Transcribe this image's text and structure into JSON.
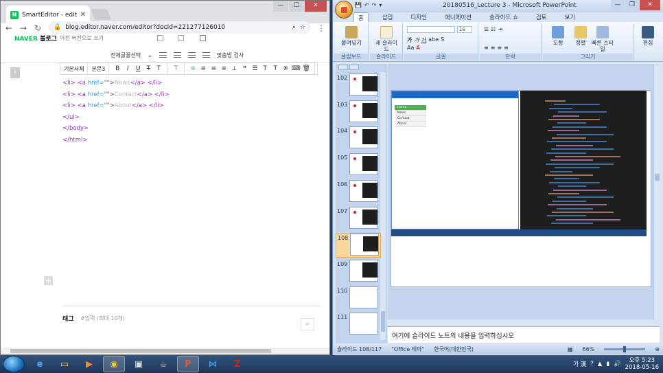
{
  "chrome": {
    "tab_title": "SmartEditor - editor",
    "url": "blog.editor.naver.com/editor?docId=221277126010",
    "header": {
      "logo_naver": "NAVER",
      "logo_blog": "블로그",
      "prev_version": "이전 버전으로 쓰기"
    },
    "toolbar1": {
      "font_size_select": "전체글꼴선택",
      "spellcheck": "맞춤법 검사"
    },
    "toolbar2": {
      "style_select": "기본서체",
      "size_select": "본문3"
    },
    "code_lines": [
      {
        "pre": "<li> <a ",
        "attr": "href=",
        "str": "\"\">",
        "text": "News",
        "post": "</a> </li>"
      },
      {
        "pre": "<li> <a ",
        "attr": "href=",
        "str": "\"\">",
        "text": "Contact",
        "post": "</a> </li>"
      },
      {
        "pre": "<li> <a ",
        "attr": "href=",
        "str": "\"\">",
        "text": "About",
        "post": "</a> </li>"
      },
      {
        "pre": "</ul>",
        "attr": "",
        "str": "",
        "text": "",
        "post": ""
      },
      {
        "pre": "</body>",
        "attr": "",
        "str": "",
        "text": "",
        "post": ""
      },
      {
        "pre": "</html>",
        "attr": "",
        "str": "",
        "text": "",
        "post": ""
      }
    ],
    "tag_label": "태그",
    "tag_placeholder": "#입력 (최대 10개)"
  },
  "ppt": {
    "title": "20180516_Lecture 3 - Microsoft PowerPoint",
    "tabs": [
      "홈",
      "삽입",
      "디자인",
      "애니메이션",
      "슬라이드 쇼",
      "검토",
      "보기"
    ],
    "active_tab": "홈",
    "groups": {
      "clipboard": {
        "label": "클립보드",
        "paste": "붙여넣기"
      },
      "slides": {
        "label": "슬라이드",
        "new_slide": "새 슬라이드"
      },
      "font": {
        "label": "글꼴",
        "size": "18"
      },
      "paragraph": {
        "label": "단락"
      },
      "drawing": {
        "label": "그리기",
        "shapes": "도형",
        "arrange": "정렬",
        "quick_styles": "빠른 스타일"
      },
      "editing": {
        "label": "편집",
        "edit": "편집"
      }
    },
    "thumb_numbers": [
      "102",
      "103",
      "104",
      "105",
      "106",
      "107",
      "108",
      "109",
      "110",
      "111"
    ],
    "selected_slide": "108",
    "shot_menu": [
      "Home",
      "News",
      "Contact",
      "About"
    ],
    "notes_placeholder": "여기에 슬라이드 노트의 내용을 입력하십시오",
    "status": {
      "slide": "슬라이드 108/117",
      "theme": "\"Office 테마\"",
      "language": "한국어(대한민국)",
      "zoom": "66%"
    }
  },
  "taskbar": {
    "apps": [
      "ie-icon",
      "explorer-icon",
      "media-icon",
      "chrome-icon",
      "cmd-icon",
      "java-icon",
      "powerpoint-icon",
      "vscode-icon",
      "filezilla-icon"
    ],
    "ime": "가 漢",
    "time": "오후 5:23",
    "date": "2018-05-16"
  }
}
